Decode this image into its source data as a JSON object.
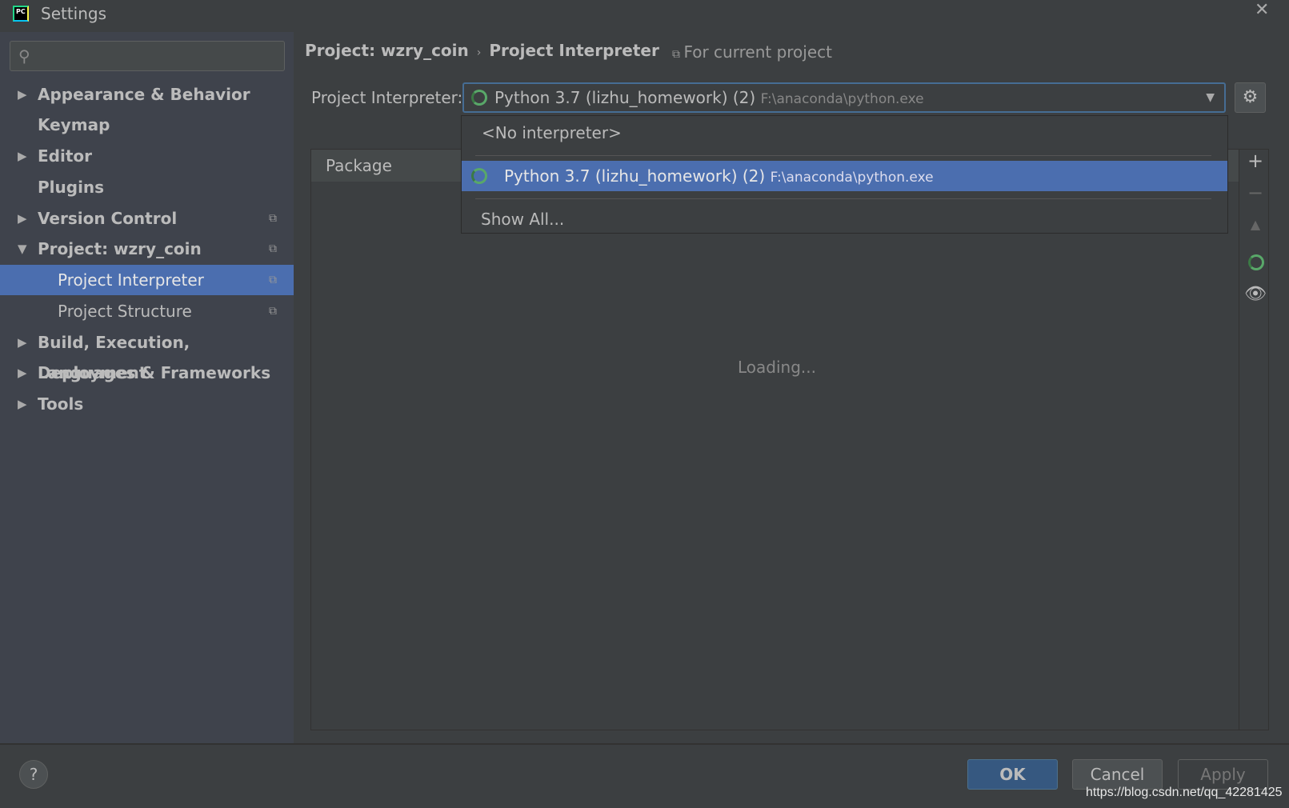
{
  "window": {
    "title": "Settings",
    "app_icon": "PC"
  },
  "search": {
    "placeholder": ""
  },
  "sidebar": {
    "items": [
      {
        "label": "Appearance & Behavior",
        "arrow": "▶"
      },
      {
        "label": "Keymap",
        "arrow": ""
      },
      {
        "label": "Editor",
        "arrow": "▶"
      },
      {
        "label": "Plugins",
        "arrow": ""
      },
      {
        "label": "Version Control",
        "arrow": "▶"
      },
      {
        "label": "Project: wzry_coin",
        "arrow": "▼"
      },
      {
        "label": "Project Interpreter",
        "arrow": ""
      },
      {
        "label": "Project Structure",
        "arrow": ""
      },
      {
        "label": "Build, Execution, Deployment",
        "arrow": "▶"
      },
      {
        "label": "Languages & Frameworks",
        "arrow": "▶"
      },
      {
        "label": "Tools",
        "arrow": "▶"
      }
    ]
  },
  "breadcrumb": {
    "parent": "Project: wzry_coin",
    "sep": "›",
    "current": "Project Interpreter",
    "scope": "For current project"
  },
  "interpreter": {
    "label": "Project Interpreter:",
    "name": "Python 3.7 (lizhu_homework) (2)",
    "path": "F:\\anaconda\\python.exe"
  },
  "popup": {
    "no_interpreter": "<No interpreter>",
    "selected_name": "Python 3.7 (lizhu_homework) (2)",
    "selected_path": "F:\\anaconda\\python.exe",
    "show_all": "Show All..."
  },
  "table": {
    "header": "Package",
    "loading": "Loading..."
  },
  "buttons": {
    "ok": "OK",
    "cancel": "Cancel",
    "apply": "Apply",
    "help": "?"
  },
  "watermark": "https://blog.csdn.net/qq_42281425",
  "colors": {
    "selection": "#4b6eaf",
    "spinner": "#59a869",
    "ok": "#365880"
  }
}
